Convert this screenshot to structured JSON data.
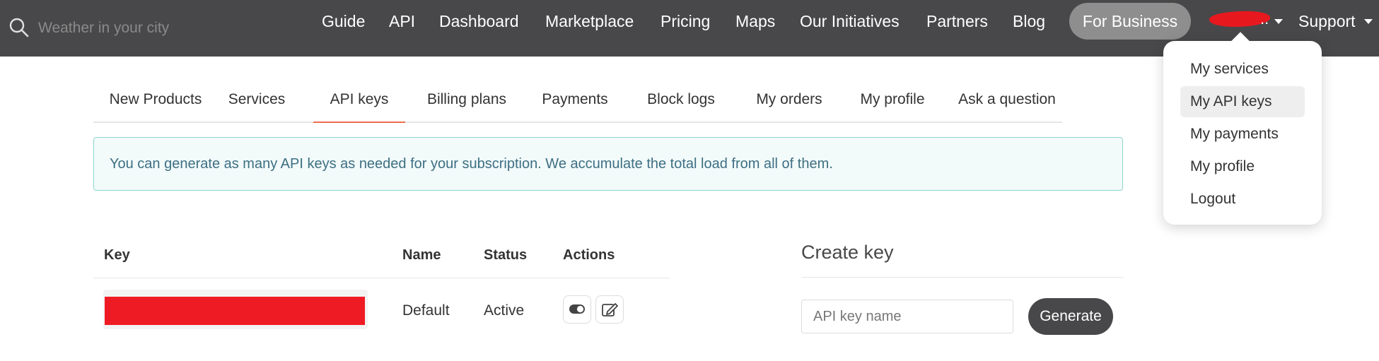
{
  "search": {
    "placeholder": "Weather in your city"
  },
  "nav": {
    "guide": "Guide",
    "api": "API",
    "dashboard": "Dashboard",
    "marketplace": "Marketplace",
    "pricing": "Pricing",
    "maps": "Maps",
    "initiatives": "Our Initiatives",
    "partners": "Partners",
    "blog": "Blog",
    "for_business": "For Business",
    "user_suffix": "..",
    "support": "Support"
  },
  "user_dropdown": {
    "items": [
      {
        "label": "My services",
        "active": false
      },
      {
        "label": "My API keys",
        "active": true
      },
      {
        "label": "My payments",
        "active": false
      },
      {
        "label": "My profile",
        "active": false
      },
      {
        "label": "Logout",
        "active": false
      }
    ]
  },
  "tabs": [
    {
      "label": "New Products",
      "active": false
    },
    {
      "label": "Services",
      "active": false
    },
    {
      "label": "API keys",
      "active": true
    },
    {
      "label": "Billing plans",
      "active": false
    },
    {
      "label": "Payments",
      "active": false
    },
    {
      "label": "Block logs",
      "active": false
    },
    {
      "label": "My orders",
      "active": false
    },
    {
      "label": "My profile",
      "active": false
    },
    {
      "label": "Ask a question",
      "active": false
    }
  ],
  "alert": {
    "text": "You can generate as many API keys as needed for your subscription. We accumulate the total load from all of them."
  },
  "keys_table": {
    "headers": {
      "key": "Key",
      "name": "Name",
      "status": "Status",
      "actions": "Actions"
    },
    "rows": [
      {
        "name": "Default",
        "status": "Active"
      }
    ]
  },
  "create_key": {
    "title": "Create key",
    "name_placeholder": "API key name",
    "generate_label": "Generate"
  },
  "colors": {
    "topbar": "#48484a",
    "accent_tab": "#eb6e4b",
    "alert_border": "#8fd7d0",
    "alert_text": "#3d6f82"
  }
}
